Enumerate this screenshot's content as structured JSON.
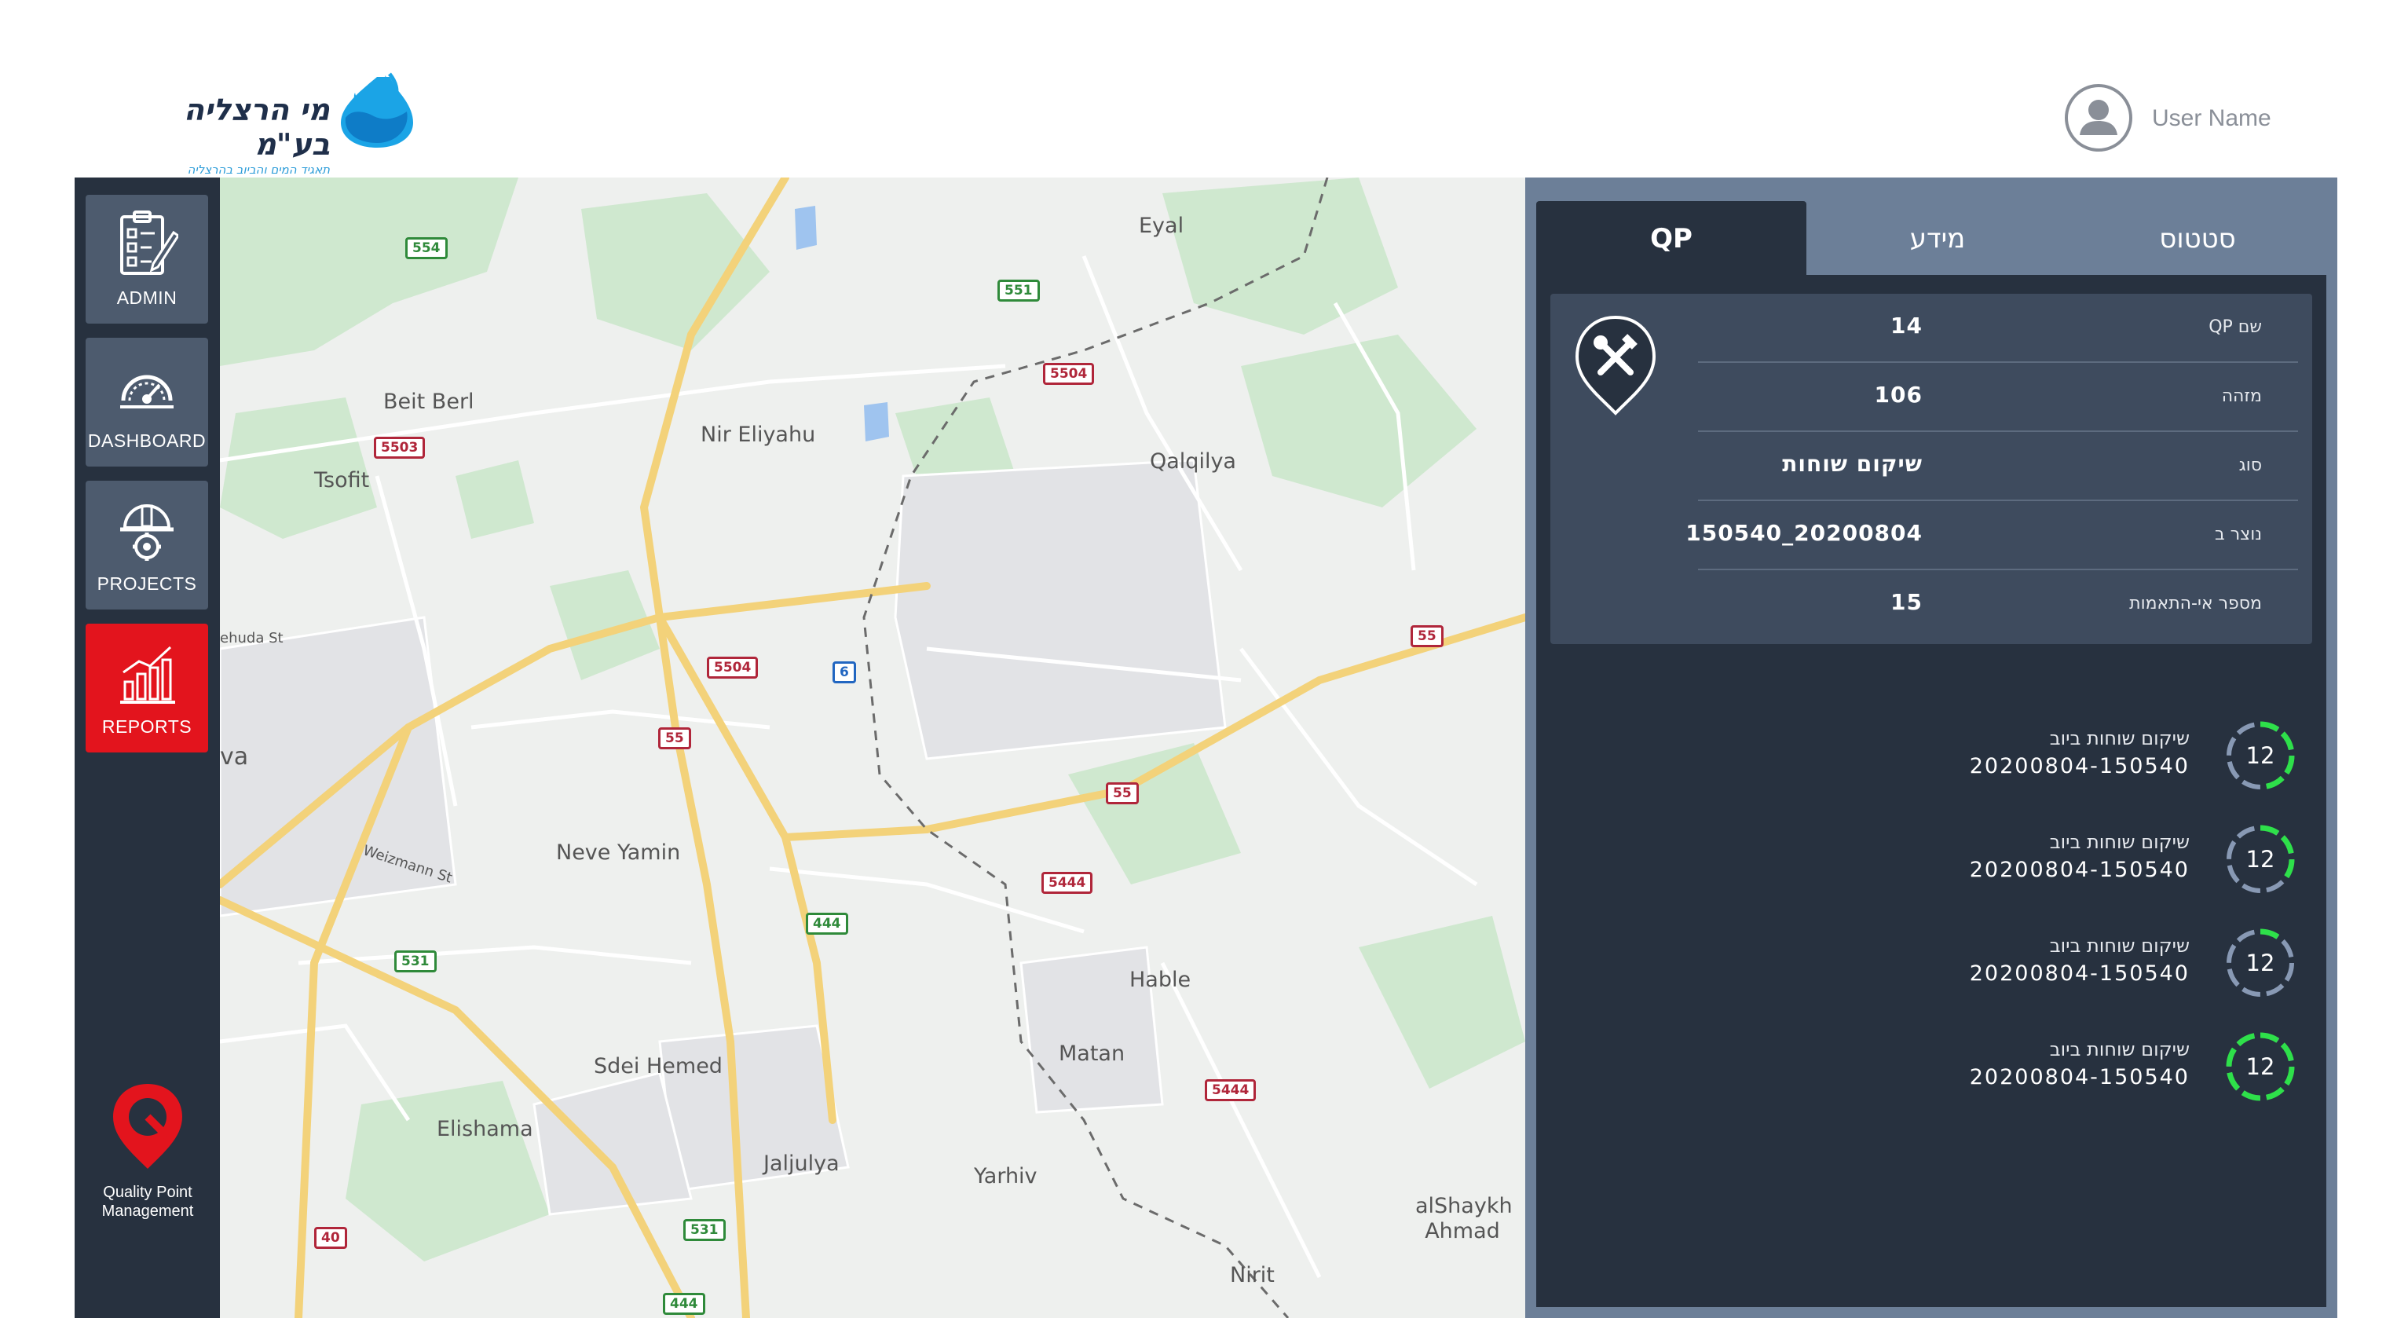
{
  "header": {
    "logo_title": "מי הרצליה בע\"מ",
    "logo_subtitle": "תאגיד המים והביוב בהרצליה",
    "user_name": "User Name",
    "icons": [
      "water-drop-icon",
      "user-avatar-icon"
    ]
  },
  "sidebar": {
    "items": [
      {
        "label": "ADMIN",
        "icon": "checklist-icon"
      },
      {
        "label": "DASHBOARD",
        "icon": "gauge-icon"
      },
      {
        "label": "PROJECTS",
        "icon": "hardhat-gear-icon"
      },
      {
        "label": "REPORTS",
        "icon": "bar-chart-icon",
        "active": true
      }
    ],
    "brand": {
      "line1": "Quality Point",
      "line2": "Management"
    },
    "colors": {
      "bg": "#27313f",
      "item": "#4d5b6e",
      "active": "#e3141d"
    }
  },
  "map": {
    "places": [
      "Eyal",
      "Beit Berl",
      "Nir Eliyahu",
      "Qalqilya",
      "Tsofit",
      "Neve Yamin",
      "Hable",
      "Matan",
      "Sdei Hemed",
      "Elishama",
      "Jaljulya",
      "Yarhiv",
      "alShaykh Ahmad",
      "Nirit",
      "Weizmann St",
      "ehuda St",
      "va"
    ],
    "shields": [
      "554",
      "551",
      "5504",
      "5503",
      "5504",
      "6",
      "55",
      "55",
      "55",
      "5444",
      "444",
      "531",
      "5444",
      "531",
      "40",
      "444"
    ]
  },
  "panel": {
    "tabs": [
      {
        "label": "QP",
        "active": true
      },
      {
        "label": "מידע"
      },
      {
        "label": "סטטוס"
      }
    ],
    "qp_details": [
      {
        "key": "שם QP",
        "value": "14"
      },
      {
        "key": "מזהה",
        "value": "106"
      },
      {
        "key": "סוג",
        "value": "שיקום שוחות"
      },
      {
        "key": "נוצר ב",
        "value": "20200804_150540"
      },
      {
        "key": "מספר אי-התאמות",
        "value": "15"
      }
    ],
    "list": [
      {
        "title": "שיקום שוחות ביוב",
        "subtitle": "20200804-150540",
        "count": "12",
        "progress": 0.55
      },
      {
        "title": "שיקום שוחות ביוב",
        "subtitle": "20200804-150540",
        "count": "12",
        "progress": 0.4
      },
      {
        "title": "שיקום שוחות ביוב",
        "subtitle": "20200804-150540",
        "count": "12",
        "progress": 0.15
      },
      {
        "title": "שיקום שוחות ביוב",
        "subtitle": "20200804-150540",
        "count": "12",
        "progress": 1.0
      }
    ],
    "colors": {
      "panel": "#6c7f98",
      "body": "#27313f",
      "card": "#3e4b5e",
      "ring_progress": "#2ee04a",
      "ring_track": "#8899b4"
    }
  }
}
